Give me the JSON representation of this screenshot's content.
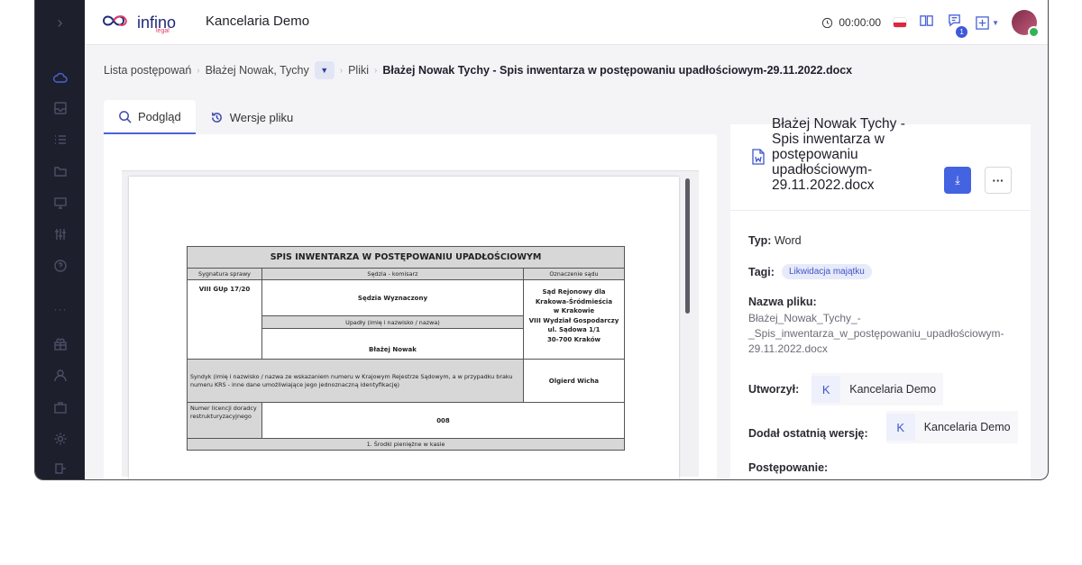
{
  "header": {
    "logo_text": "infino",
    "logo_sub": "legal",
    "app_name": "Kancelaria Demo",
    "timer": "00:00:00",
    "notification_count": "1"
  },
  "breadcrumb": {
    "items": [
      "Lista postępowań",
      "Błażej Nowak, Tychy",
      "Pliki"
    ],
    "current": "Błażej Nowak Tychy - Spis inwentarza w postępowaniu upadłościowym-29.11.2022.docx"
  },
  "tabs": [
    {
      "label": "Podgląd",
      "icon": "search-icon"
    },
    {
      "label": "Wersje pliku",
      "icon": "history-icon"
    }
  ],
  "document": {
    "title": "SPIS INWENTARZA W POSTĘPOWANIU UPADŁOŚCIOWYM",
    "col_sygnatura": "Sygnatura sprawy",
    "col_sedzia": "Sędzia - komisarz",
    "col_sad": "Oznaczenie sądu",
    "sygnatura": "VIII GUp 17/20",
    "sedzia": "Sędzia Wyznaczony",
    "sad_lines": [
      "Sąd Rejonowy dla Krakowa-Śródmieścia",
      "w Krakowie",
      "VIII Wydział Gospodarczy",
      "ul. Sądowa 1/1",
      "30-700 Kraków"
    ],
    "upadly_label": "Upadły (imię i nazwisko / nazwa)",
    "upadly": "Błażej Nowak",
    "syndyk_label": "Syndyk (imię i nazwisko / nazwa ze wskazaniem numeru w Krajowym Rejestrze Sądowym, a w przypadku braku numeru KRS - inne dane umożliwiające jego jednoznaczną identyfikację)",
    "syndyk": "Olgierd Wicha",
    "licencja_label": "Numer licencji doradcy restrukturyzacyjnego",
    "licencja": "008",
    "section1": "1. Środki pieniężne w kasie"
  },
  "file_info": {
    "title": "Błażej Nowak Tychy - Spis inwentarza w postępowaniu upadłościowym-29.11.2022.docx",
    "type_label": "Typ:",
    "type_value": "Word",
    "tags_label": "Tagi:",
    "tag": "Likwidacja majątku",
    "filename_label": "Nazwa pliku:",
    "filename_value": "Błażej_Nowak_Tychy_-_Spis_inwentarza_w_postępowaniu_upadłościowym-29.11.2022.docx",
    "created_label": "Utworzył:",
    "created_initial": "K",
    "created_by": "Kancelaria Demo",
    "added_label": "Dodał ostatnią wersję:",
    "added_initial": "K",
    "added_by": "Kancelaria Demo",
    "proceeding_label": "Postępowanie:"
  },
  "colors": {
    "sidebar": "#1e1f2c",
    "accent": "#4463e0",
    "tag_bg": "#e7eafa"
  }
}
